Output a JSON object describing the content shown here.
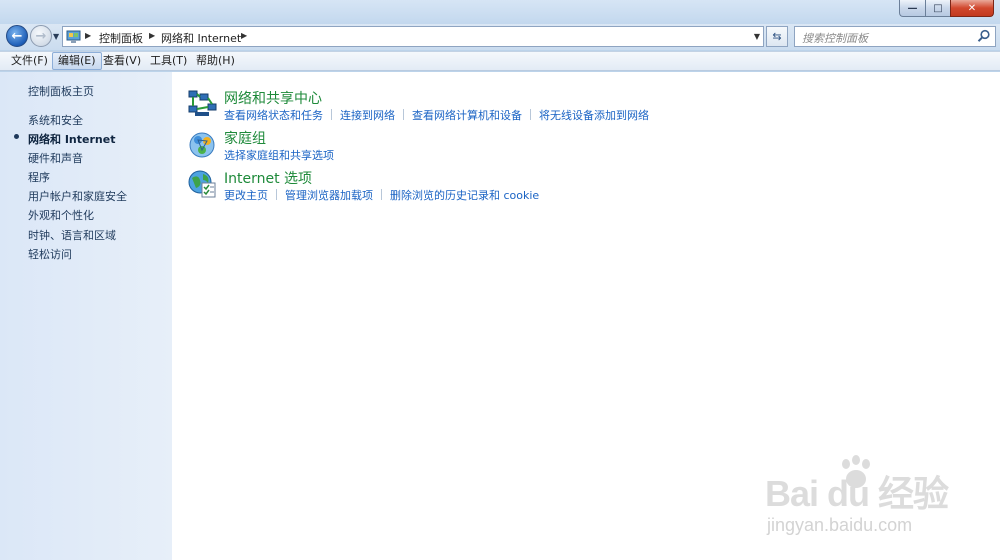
{
  "window": {
    "controls": {
      "minimize": "—",
      "maximize": "□",
      "close": "✕"
    }
  },
  "address_bar": {
    "crumbs": [
      "控制面板",
      "网络和 Internet"
    ],
    "search_placeholder": "搜索控制面板"
  },
  "menu": {
    "items": [
      "文件(F)",
      "编辑(E)",
      "查看(V)",
      "工具(T)",
      "帮助(H)"
    ],
    "active_index": 1
  },
  "sidebar": {
    "home": "控制面板主页",
    "items": [
      {
        "label": "系统和安全",
        "current": false
      },
      {
        "label": "网络和 Internet",
        "current": true
      },
      {
        "label": "硬件和声音",
        "current": false
      },
      {
        "label": "程序",
        "current": false
      },
      {
        "label": "用户帐户和家庭安全",
        "current": false
      },
      {
        "label": "外观和个性化",
        "current": false
      },
      {
        "label": "时钟、语言和区域",
        "current": false
      },
      {
        "label": "轻松访问",
        "current": false
      }
    ]
  },
  "categories": [
    {
      "title": "网络和共享中心",
      "icon": "network-center-icon",
      "links": [
        "查看网络状态和任务",
        "连接到网络",
        "查看网络计算机和设备",
        "将无线设备添加到网络"
      ]
    },
    {
      "title": "家庭组",
      "icon": "homegroup-icon",
      "links": [
        "选择家庭组和共享选项"
      ]
    },
    {
      "title": "Internet 选项",
      "icon": "internet-options-icon",
      "links": [
        "更改主页",
        "管理浏览器加载项",
        "删除浏览的历史记录和 cookie"
      ]
    }
  ],
  "watermark": {
    "brand": "Bai du 经验",
    "site": "jingyan.baidu.com"
  },
  "colors": {
    "link": "#1a63c4",
    "category_title": "#1e8a3a",
    "sidebar_bg": "#dbe7f7",
    "close_button": "#c23a1f"
  }
}
